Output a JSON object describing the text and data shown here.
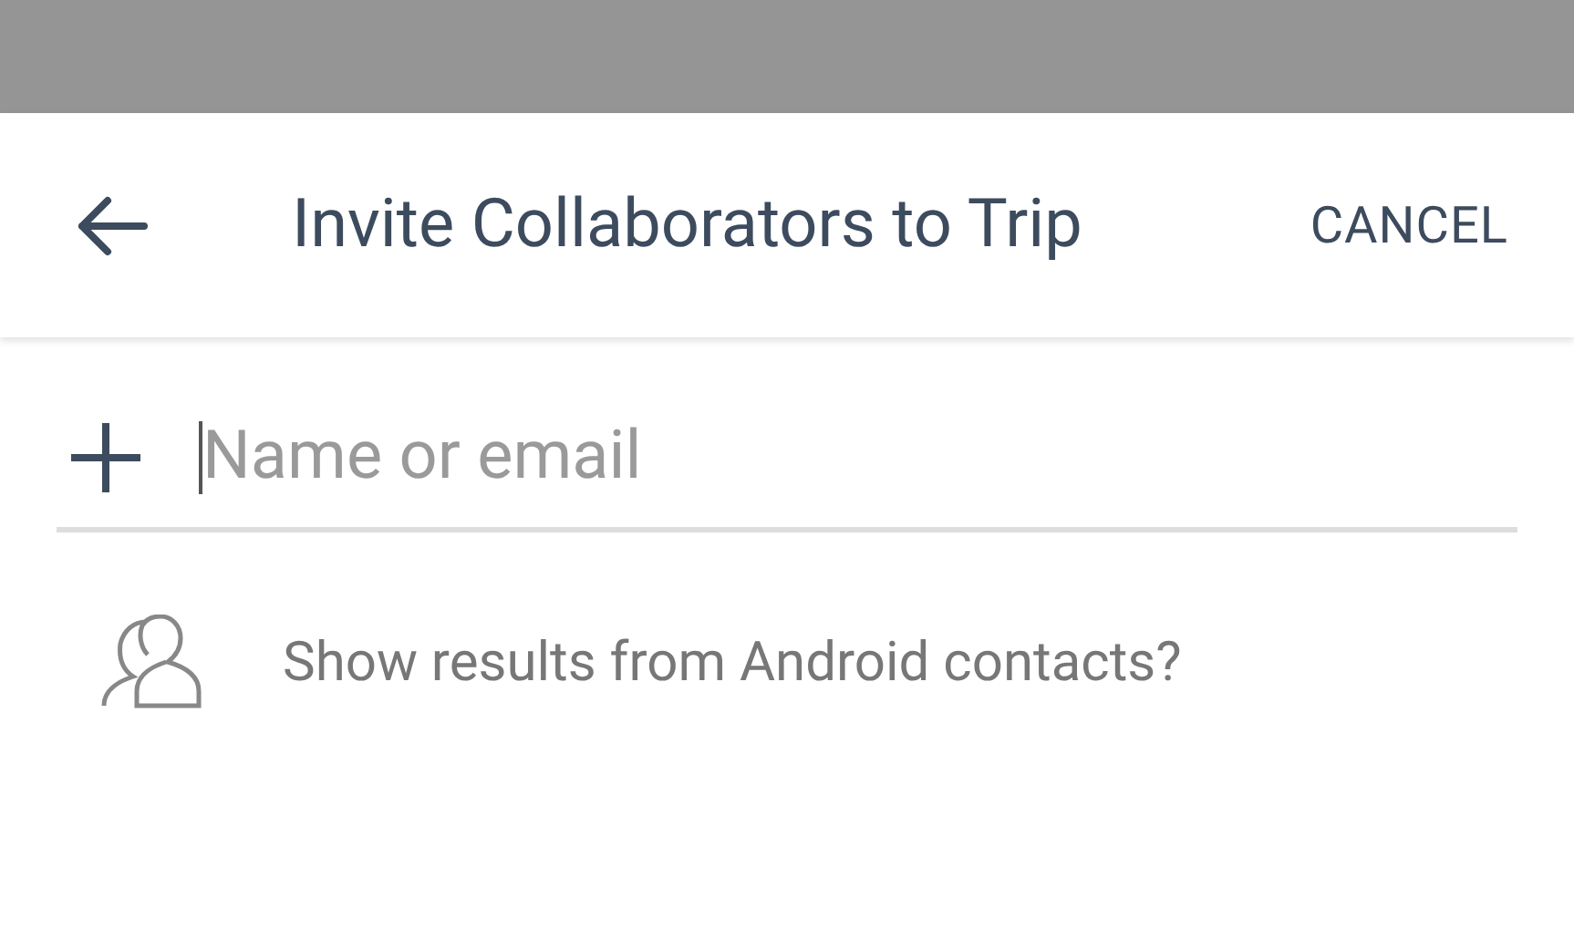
{
  "header": {
    "title": "Invite Collaborators to Trip",
    "action": "CANCEL"
  },
  "invite_field": {
    "placeholder": "Name or email",
    "focused": true
  },
  "contacts_prompt": {
    "text": "Show results from Android contacts?"
  }
}
